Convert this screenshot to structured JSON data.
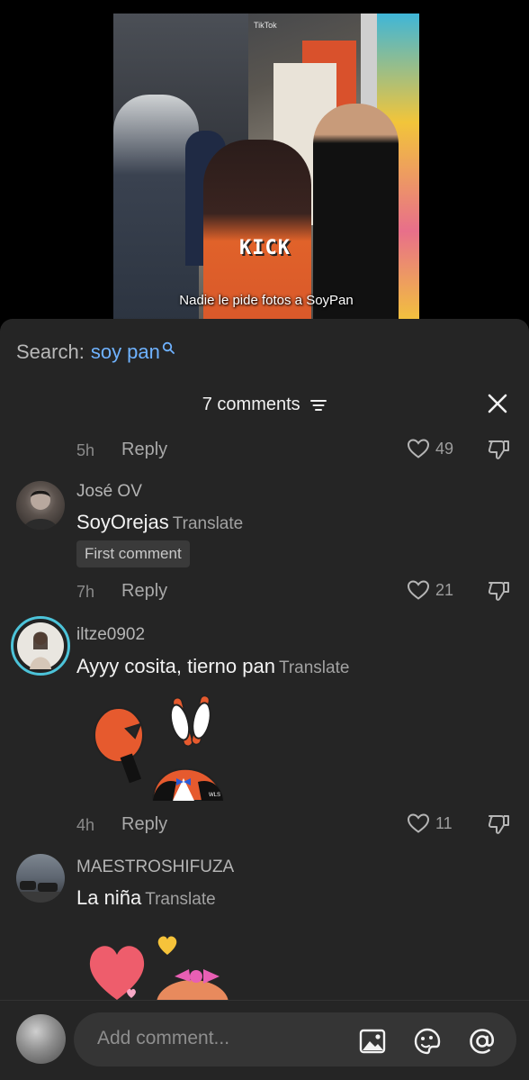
{
  "video": {
    "watermark": "TikTok",
    "brand_overlay": "KICK",
    "caption": "Nadie le pide fotos a SoyPan"
  },
  "search": {
    "label": "Search:",
    "term": "soy pan"
  },
  "header": {
    "comments_count": "7 comments"
  },
  "comments": [
    {
      "username": "",
      "text": "",
      "time": "5h",
      "reply": "Reply",
      "likes": "49"
    },
    {
      "username": "José OV",
      "text": "SoyOrejas",
      "translate": "Translate",
      "badge": "First comment",
      "time": "7h",
      "reply": "Reply",
      "likes": "21"
    },
    {
      "username": "iltze0902",
      "text": "Ayyy cosita, tierno pan",
      "translate": "Translate",
      "sticker": "Mr. Krabs sticker",
      "time": "4h",
      "reply": "Reply",
      "likes": "11"
    },
    {
      "username": "MAESTROSHIFUZA",
      "text": "La niña",
      "translate": "Translate",
      "sticker": "hearts and bow sticker"
    }
  ],
  "input": {
    "placeholder": "Add comment..."
  },
  "colors": {
    "sheet_bg": "#252525",
    "search_term": "#6fb2ff",
    "text_primary": "#f2f2f2",
    "text_secondary": "#a9a9a9"
  }
}
